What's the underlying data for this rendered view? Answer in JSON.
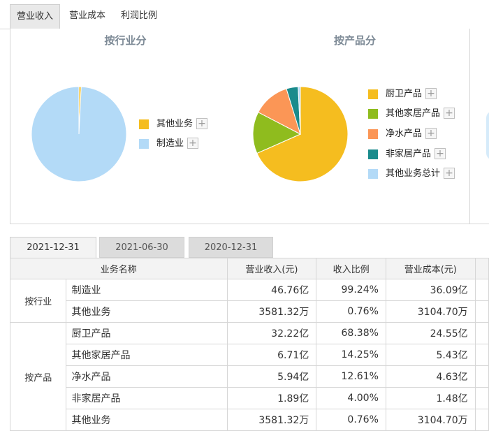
{
  "top_tabs": [
    "营业收入",
    "营业成本",
    "利润比例"
  ],
  "charts": [
    {
      "title": "按行业分",
      "slices": [
        {
          "name": "其他业务",
          "value": 0.76,
          "color": "#f5bd1f"
        },
        {
          "name": "制造业",
          "value": 99.24,
          "color": "#b3daf7"
        }
      ]
    },
    {
      "title": "按产品分",
      "slices": [
        {
          "name": "厨卫产品",
          "value": 68.38,
          "color": "#f5bd1f"
        },
        {
          "name": "其他家居产品",
          "value": 14.25,
          "color": "#8fbc1e"
        },
        {
          "name": "净水产品",
          "value": 12.61,
          "color": "#fb9656"
        },
        {
          "name": "非家居产品",
          "value": 4.0,
          "color": "#1a8b8c"
        },
        {
          "name": "其他业务总计",
          "value": 0.76,
          "color": "#b3daf7"
        }
      ]
    }
  ],
  "plus_symbol": "+",
  "date_tabs": [
    "2021-12-31",
    "2021-06-30",
    "2020-12-31"
  ],
  "table": {
    "headers": [
      "业务名称",
      "营业收入(元)",
      "收入比例",
      "营业成本(元)"
    ],
    "groups": [
      {
        "label": "按行业",
        "rows": [
          [
            "制造业",
            "46.76亿",
            "99.24%",
            "36.09亿"
          ],
          [
            "其他业务",
            "3581.32万",
            "0.76%",
            "3104.70万"
          ]
        ]
      },
      {
        "label": "按产品",
        "rows": [
          [
            "厨卫产品",
            "32.22亿",
            "68.38%",
            "24.55亿"
          ],
          [
            "其他家居产品",
            "6.71亿",
            "14.25%",
            "5.43亿"
          ],
          [
            "净水产品",
            "5.94亿",
            "12.61%",
            "4.63亿"
          ],
          [
            "非家居产品",
            "1.89亿",
            "4.00%",
            "1.48亿"
          ],
          [
            "其他业务",
            "3581.32万",
            "0.76%",
            "3104.70万"
          ]
        ]
      }
    ]
  },
  "chart_data": [
    {
      "type": "pie",
      "title": "按行业分",
      "categories": [
        "其他业务",
        "制造业"
      ],
      "values": [
        0.76,
        99.24
      ]
    },
    {
      "type": "pie",
      "title": "按产品分",
      "categories": [
        "厨卫产品",
        "其他家居产品",
        "净水产品",
        "非家居产品",
        "其他业务总计"
      ],
      "values": [
        68.38,
        14.25,
        12.61,
        4.0,
        0.76
      ]
    }
  ]
}
